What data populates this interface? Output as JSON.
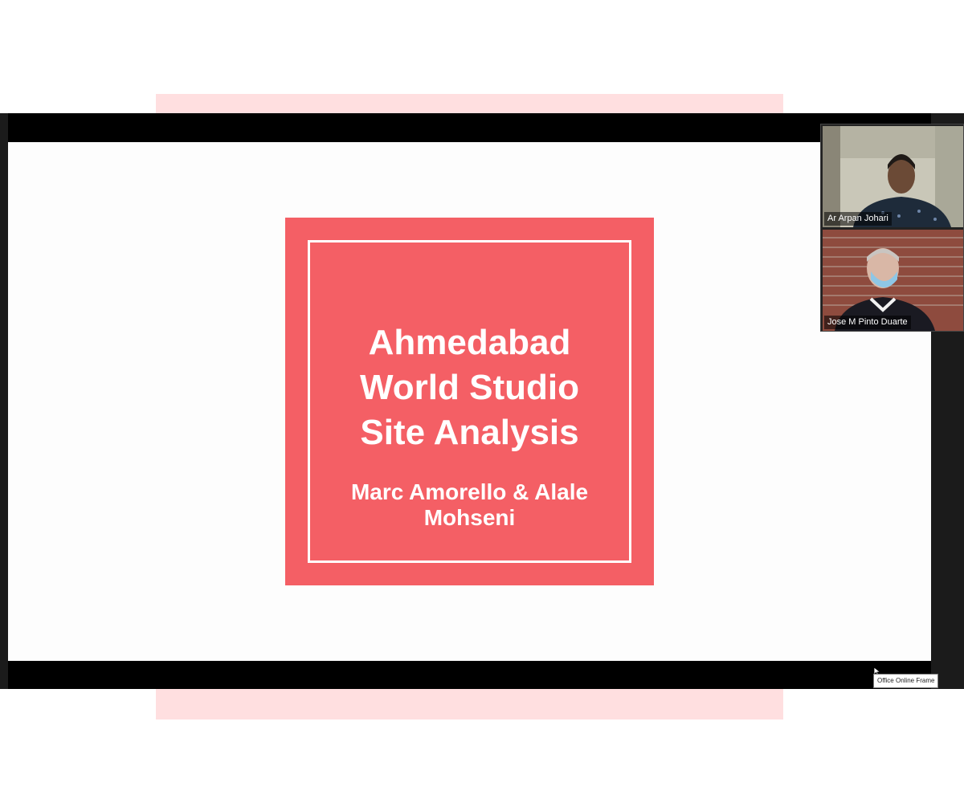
{
  "slide": {
    "title": "Ahmedabad\nWorld Studio\nSite Analysis",
    "subtitle": "Marc Amorello & Alale\nMohseni"
  },
  "participants": [
    {
      "name": "Ar Arpan Johari"
    },
    {
      "name": "Jose M Pinto Duarte"
    }
  ],
  "tooltip": {
    "text": "Office Online Frame"
  },
  "icons": {
    "cursor": "mouse-pointer-icon"
  },
  "colors": {
    "slide_accent": "#f45f65",
    "page_band": "#ffdfe0",
    "letterbox": "#000000"
  }
}
